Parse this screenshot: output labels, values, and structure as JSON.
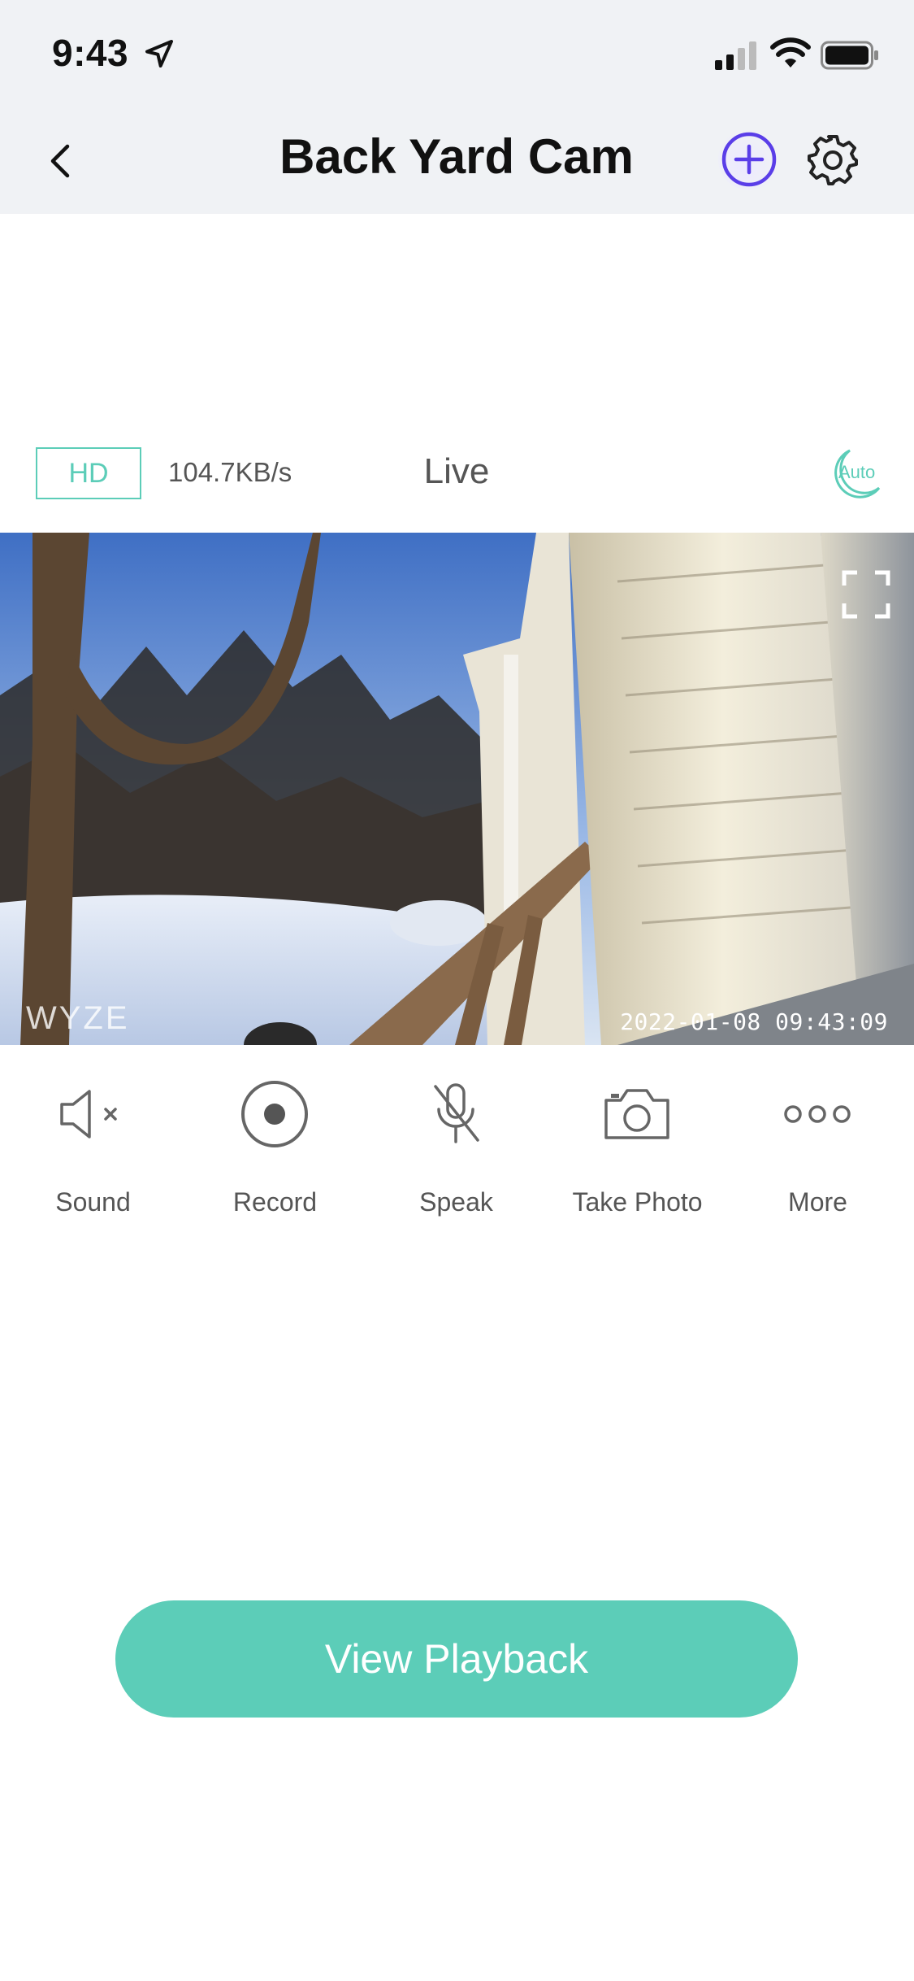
{
  "status_bar": {
    "time": "9:43",
    "icons": [
      "location-arrow-icon",
      "cellular-signal-icon",
      "wifi-icon",
      "battery-icon"
    ]
  },
  "header": {
    "title": "Back Yard Cam",
    "back_icon": "chevron-left-icon",
    "add_icon": "plus-circle-icon",
    "settings_icon": "gear-icon"
  },
  "live_bar": {
    "quality": "HD",
    "bitrate": "104.7KB/s",
    "mode_label": "Live",
    "night_mode_label": "Auto"
  },
  "video": {
    "watermark": "WYZE",
    "timestamp": "2022-01-08  09:43:09",
    "fullscreen_icon": "fullscreen-icon"
  },
  "controls": [
    {
      "label": "Sound",
      "icon": "speaker-muted-icon"
    },
    {
      "label": "Record",
      "icon": "record-icon"
    },
    {
      "label": "Speak",
      "icon": "mic-off-icon"
    },
    {
      "label": "Take Photo",
      "icon": "camera-icon"
    },
    {
      "label": "More",
      "icon": "more-dots-icon"
    }
  ],
  "playback": {
    "label": "View Playback"
  },
  "colors": {
    "accent": "#5ccdb8",
    "header_bg": "#f0f2f5",
    "add_icon": "#5a3ee8",
    "text_gray": "#555555"
  }
}
